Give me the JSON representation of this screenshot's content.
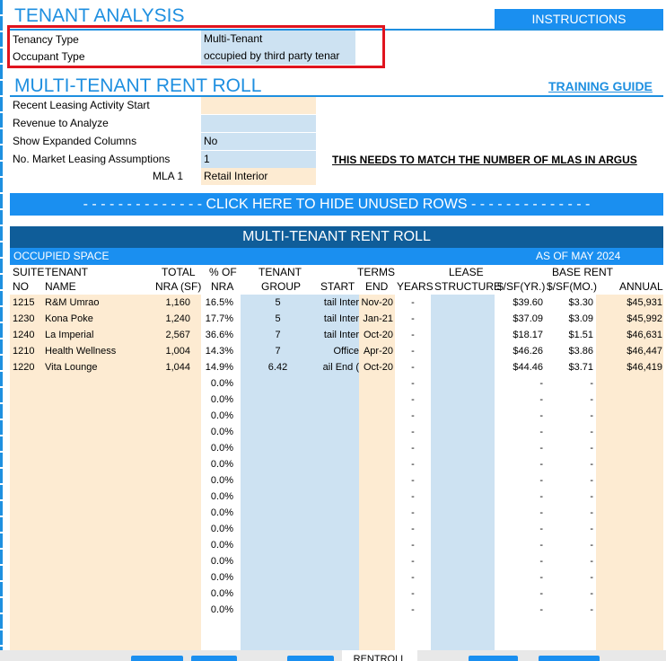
{
  "header": {
    "title": "TENANT ANALYSIS",
    "instructions_label": "INSTRUCTIONS"
  },
  "tenancy": {
    "tenancy_type_label": "Tenancy Type",
    "tenancy_type_value": "Multi-Tenant",
    "occupant_type_label": "Occupant Type",
    "occupant_type_value": "occupied by third party tenar"
  },
  "rentroll_section": {
    "title": "MULTI-TENANT RENT ROLL",
    "training_guide": "TRAINING GUIDE",
    "recent_leasing_label": "Recent Leasing Activity Start",
    "recent_leasing_value": "",
    "revenue_label": "Revenue to Analyze",
    "revenue_value": "",
    "expanded_label": "Show Expanded Columns",
    "expanded_value": "No",
    "mla_count_label": "No. Market Leasing Assumptions",
    "mla_count_value": "1",
    "mla_note": "THIS NEEDS TO MATCH THE NUMBER OF MLAS IN ARGUS",
    "mla1_label": "MLA 1",
    "mla1_value": "Retail Interior",
    "hide_rows": "- - - - - - - - - - - - - - CLICK HERE TO HIDE UNUSED ROWS - - - - - - - - - - - - - -"
  },
  "table": {
    "title": "MULTI-TENANT RENT ROLL",
    "occupied_space": "OCCUPIED SPACE",
    "as_of": "AS OF MAY 2024",
    "headers": {
      "suite1": "SUITE",
      "suite2": "NO",
      "tenant1": "TENANT",
      "tenant2": "NAME",
      "nra1": "TOTAL",
      "nra2": "NRA (SF)",
      "pct1": "% OF",
      "pct2": "NRA",
      "group1": "TENANT",
      "group2": "GROUP",
      "terms": "TERMS",
      "start": "START",
      "end": "END",
      "years": "YEARS",
      "lease1": "LEASE",
      "lease2": "STRUCTURE",
      "base_rent": "BASE RENT",
      "sfyr": "$/SF(YR.)",
      "sfmo": "$/SF(MO.)",
      "annual": "ANNUAL"
    },
    "rows": [
      {
        "suite": "1215",
        "name": "R&M Umrao",
        "nra": "1,160",
        "pct": "16.5%",
        "group": "5",
        "start": "tail Inter",
        "end": "Nov-20",
        "years": "-",
        "lease": "",
        "sfyr": "$39.60",
        "sfmo": "$3.30",
        "annual": "$45,931"
      },
      {
        "suite": "1230",
        "name": "Kona Poke",
        "nra": "1,240",
        "pct": "17.7%",
        "group": "5",
        "start": "tail Inter",
        "end": "Jan-21",
        "years": "-",
        "lease": "",
        "sfyr": "$37.09",
        "sfmo": "$3.09",
        "annual": "$45,992"
      },
      {
        "suite": "1240",
        "name": "La Imperial",
        "nra": "2,567",
        "pct": "36.6%",
        "group": "7",
        "start": "tail Inter",
        "end": "Oct-20",
        "years": "-",
        "lease": "",
        "sfyr": "$18.17",
        "sfmo": "$1.51",
        "annual": "$46,631"
      },
      {
        "suite": "1210",
        "name": "Health Wellness",
        "nra": "1,004",
        "pct": "14.3%",
        "group": "7",
        "start": "Office",
        "end": "Apr-20",
        "years": "-",
        "lease": "",
        "sfyr": "$46.26",
        "sfmo": "$3.86",
        "annual": "$46,447"
      },
      {
        "suite": "1220",
        "name": "Vita Lounge",
        "nra": "1,044",
        "pct": "14.9%",
        "group": "6.42",
        "start": "ail End (",
        "end": "Oct-20",
        "years": "-",
        "lease": "",
        "sfyr": "$44.46",
        "sfmo": "$3.71",
        "annual": "$46,419"
      },
      {
        "suite": "",
        "name": "",
        "nra": "",
        "pct": "0.0%",
        "group": "",
        "start": "",
        "end": "",
        "years": "-",
        "lease": "",
        "sfyr": "-",
        "sfmo": "-",
        "annual": ""
      },
      {
        "suite": "",
        "name": "",
        "nra": "",
        "pct": "0.0%",
        "group": "",
        "start": "",
        "end": "",
        "years": "-",
        "lease": "",
        "sfyr": "-",
        "sfmo": "-",
        "annual": ""
      },
      {
        "suite": "",
        "name": "",
        "nra": "",
        "pct": "0.0%",
        "group": "",
        "start": "",
        "end": "",
        "years": "-",
        "lease": "",
        "sfyr": "-",
        "sfmo": "-",
        "annual": ""
      },
      {
        "suite": "",
        "name": "",
        "nra": "",
        "pct": "0.0%",
        "group": "",
        "start": "",
        "end": "",
        "years": "-",
        "lease": "",
        "sfyr": "-",
        "sfmo": "-",
        "annual": ""
      },
      {
        "suite": "",
        "name": "",
        "nra": "",
        "pct": "0.0%",
        "group": "",
        "start": "",
        "end": "",
        "years": "-",
        "lease": "",
        "sfyr": "-",
        "sfmo": "-",
        "annual": ""
      },
      {
        "suite": "",
        "name": "",
        "nra": "",
        "pct": "0.0%",
        "group": "",
        "start": "",
        "end": "",
        "years": "-",
        "lease": "",
        "sfyr": "-",
        "sfmo": "-",
        "annual": ""
      },
      {
        "suite": "",
        "name": "",
        "nra": "",
        "pct": "0.0%",
        "group": "",
        "start": "",
        "end": "",
        "years": "-",
        "lease": "",
        "sfyr": "-",
        "sfmo": "-",
        "annual": ""
      },
      {
        "suite": "",
        "name": "",
        "nra": "",
        "pct": "0.0%",
        "group": "",
        "start": "",
        "end": "",
        "years": "-",
        "lease": "",
        "sfyr": "-",
        "sfmo": "-",
        "annual": ""
      },
      {
        "suite": "",
        "name": "",
        "nra": "",
        "pct": "0.0%",
        "group": "",
        "start": "",
        "end": "",
        "years": "-",
        "lease": "",
        "sfyr": "-",
        "sfmo": "-",
        "annual": ""
      },
      {
        "suite": "",
        "name": "",
        "nra": "",
        "pct": "0.0%",
        "group": "",
        "start": "",
        "end": "",
        "years": "-",
        "lease": "",
        "sfyr": "-",
        "sfmo": "-",
        "annual": ""
      },
      {
        "suite": "",
        "name": "",
        "nra": "",
        "pct": "0.0%",
        "group": "",
        "start": "",
        "end": "",
        "years": "-",
        "lease": "",
        "sfyr": "-",
        "sfmo": "-",
        "annual": ""
      },
      {
        "suite": "",
        "name": "",
        "nra": "",
        "pct": "0.0%",
        "group": "",
        "start": "",
        "end": "",
        "years": "-",
        "lease": "",
        "sfyr": "-",
        "sfmo": "-",
        "annual": ""
      },
      {
        "suite": "",
        "name": "",
        "nra": "",
        "pct": "0.0%",
        "group": "",
        "start": "",
        "end": "",
        "years": "-",
        "lease": "",
        "sfyr": "-",
        "sfmo": "-",
        "annual": ""
      },
      {
        "suite": "",
        "name": "",
        "nra": "",
        "pct": "0.0%",
        "group": "",
        "start": "",
        "end": "",
        "years": "-",
        "lease": "",
        "sfyr": "-",
        "sfmo": "-",
        "annual": ""
      },
      {
        "suite": "",
        "name": "",
        "nra": "",
        "pct": "0.0%",
        "group": "",
        "start": "",
        "end": "",
        "years": "-",
        "lease": "",
        "sfyr": "-",
        "sfmo": "-",
        "annual": ""
      }
    ]
  },
  "sheet_tabs": {
    "active": "RENTROLL"
  },
  "colors": {
    "accent": "#1a8ff0",
    "dark_band": "#0f5d99",
    "peach": "#fdebd2",
    "light_blue": "#cde2f2",
    "highlight_box": "#e0141e"
  }
}
